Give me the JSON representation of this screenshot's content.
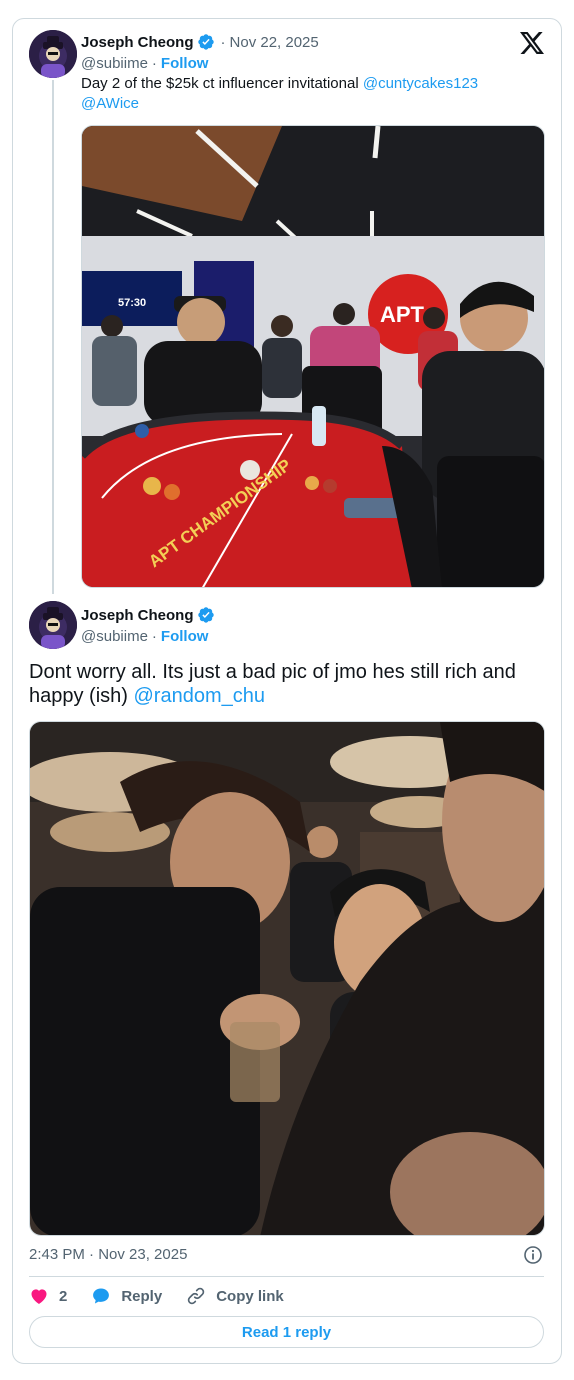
{
  "tweet1": {
    "author_name": "Joseph Cheong",
    "handle": "@subiime",
    "follow_label": "Follow",
    "date": "Nov 22, 2025",
    "text_prefix": "Day 2 of the $25k ct influencer invitational ",
    "mention1": "@cuntycakes123",
    "mention2": "@AWice",
    "photo_sign_text": "APT",
    "photo_table_text": "APT CHAMPIONSHIP",
    "photo_screen_time": "57:30"
  },
  "tweet2": {
    "author_name": "Joseph Cheong",
    "handle": "@subiime",
    "follow_label": "Follow",
    "text_prefix": "Dont worry all. Its just a bad pic of jmo hes still rich and happy (ish) ",
    "mention": "@random_chu"
  },
  "footer": {
    "timestamp": "2:43 PM · Nov 23, 2025",
    "like_count": "2",
    "reply_label": "Reply",
    "copy_link_label": "Copy link",
    "read_reply_label": "Read 1 reply"
  },
  "colors": {
    "accent": "#1d9bf0",
    "like": "#f91880",
    "text": "#0f1419",
    "muted": "#536471",
    "border": "#cfd9de"
  },
  "icons": [
    "x-logo-icon",
    "verified-badge-icon",
    "info-icon",
    "heart-icon",
    "reply-bubble-icon",
    "link-icon"
  ]
}
